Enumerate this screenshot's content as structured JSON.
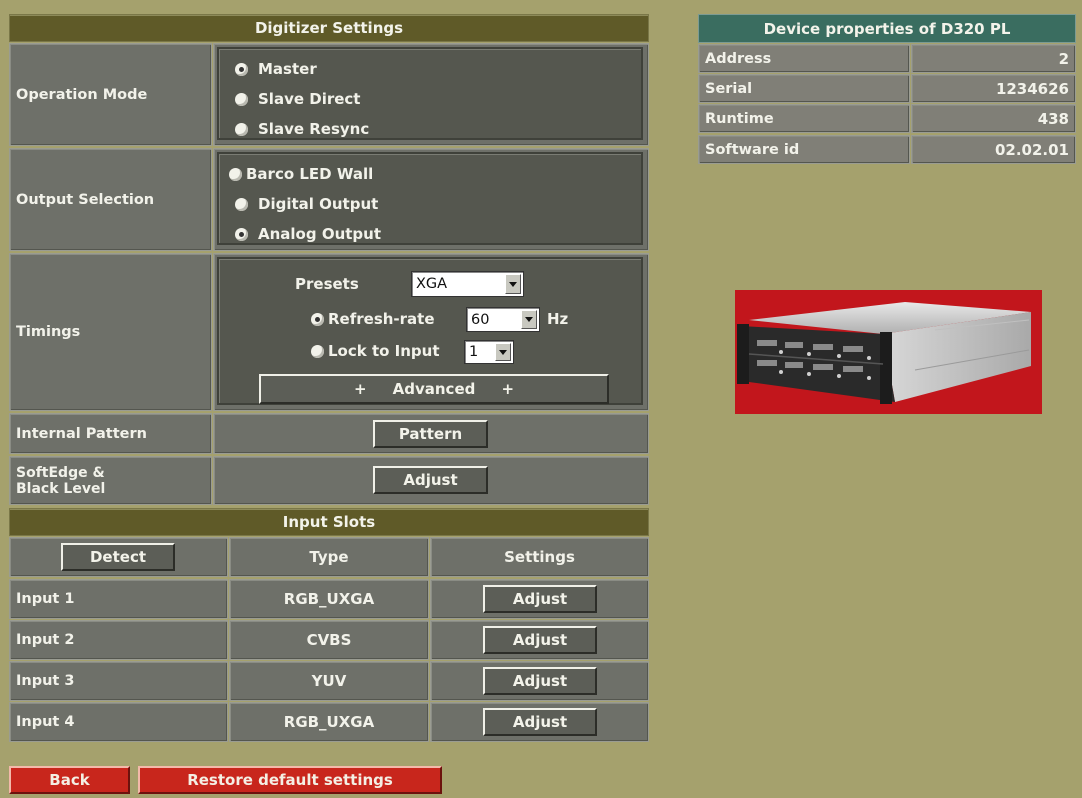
{
  "digitizer": {
    "title": "Digitizer Settings",
    "operation_mode": {
      "label": "Operation Mode",
      "options": [
        "Master",
        "Slave Direct",
        "Slave Resync"
      ],
      "selected": 0
    },
    "output_selection": {
      "label": "Output Selection",
      "options": [
        "Barco LED Wall",
        "Digital Output",
        "Analog Output"
      ],
      "selected": 2
    },
    "timings": {
      "label": "Timings",
      "presets_label": "Presets",
      "presets_value": "XGA",
      "refresh_label": "Refresh-rate",
      "refresh_value": "60",
      "refresh_unit": "Hz",
      "lock_label": "Lock to Input",
      "lock_value": "1",
      "advanced_label": "+     Advanced     +"
    },
    "internal_pattern": {
      "label": "Internal Pattern",
      "button": "Pattern"
    },
    "softedge": {
      "label_line1": "SoftEdge &",
      "label_line2": "Black Level",
      "button": "Adjust"
    }
  },
  "input_slots": {
    "title": "Input Slots",
    "detect_button": "Detect",
    "col_type": "Type",
    "col_settings": "Settings",
    "rows": [
      {
        "name": "Input 1",
        "type": "RGB_UXGA",
        "button": "Adjust"
      },
      {
        "name": "Input 2",
        "type": "CVBS",
        "button": "Adjust"
      },
      {
        "name": "Input 3",
        "type": "YUV",
        "button": "Adjust"
      },
      {
        "name": "Input 4",
        "type": "RGB_UXGA",
        "button": "Adjust"
      }
    ]
  },
  "device": {
    "title": "Device properties of D320 PL",
    "props": [
      {
        "label": "Address",
        "value": "2"
      },
      {
        "label": "Serial",
        "value": "1234626"
      },
      {
        "label": "Runtime",
        "value": "438"
      },
      {
        "label": "Software id",
        "value": "02.02.01"
      }
    ]
  },
  "footer": {
    "back": "Back",
    "restore": "Restore default settings"
  },
  "colors": {
    "background": "#a5a16d",
    "header": "#5f5a28",
    "prop_header": "#3a6d60",
    "red_button": "#c8261c"
  }
}
